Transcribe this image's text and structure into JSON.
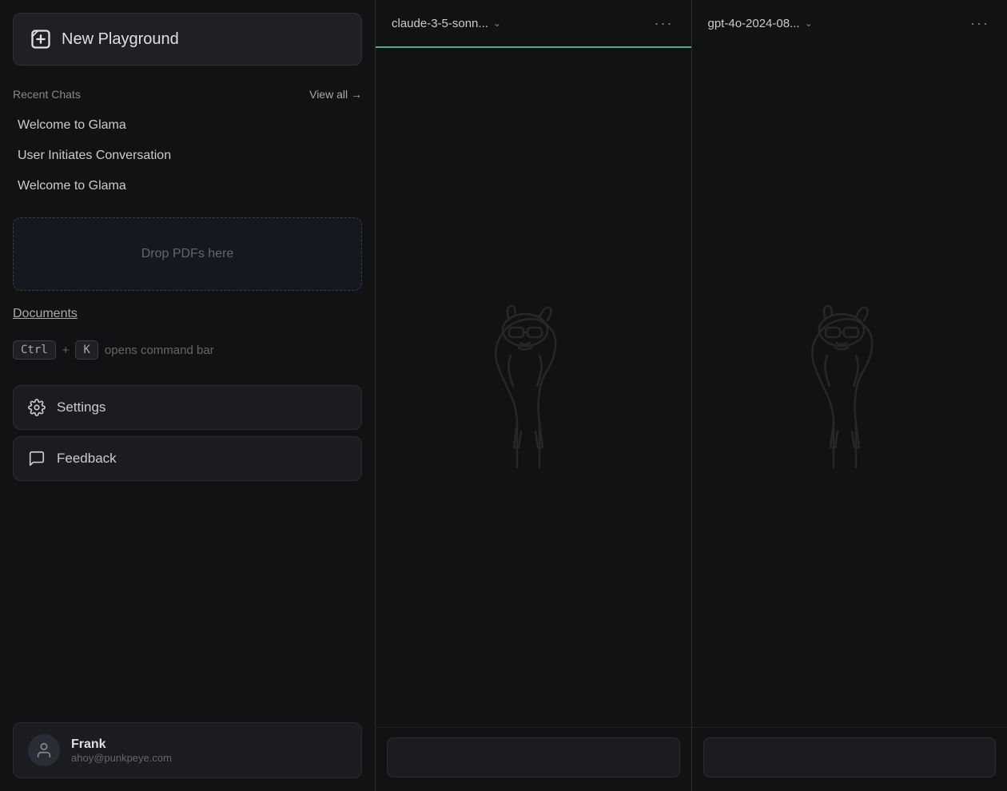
{
  "sidebar": {
    "new_playground_label": "New Playground",
    "recent_chats_label": "Recent Chats",
    "view_all_label": "View all →",
    "chats": [
      {
        "id": 1,
        "title": "Welcome to Glama"
      },
      {
        "id": 2,
        "title": "User Initiates Conversation"
      },
      {
        "id": 3,
        "title": "Welcome to Glama"
      }
    ],
    "drop_zone_label": "Drop PDFs here",
    "documents_label": "Documents",
    "keyboard_ctrl": "Ctrl",
    "keyboard_plus": "+",
    "keyboard_k": "K",
    "keyboard_hint": "opens command bar",
    "settings_label": "Settings",
    "feedback_label": "Feedback",
    "user": {
      "name": "Frank",
      "email": "ahoy@punkpeye.com"
    }
  },
  "panels": [
    {
      "id": "panel-1",
      "model_name": "claude-3-5-sonn...",
      "active": true,
      "input_placeholder": ""
    },
    {
      "id": "panel-2",
      "model_name": "gpt-4o-2024-08...",
      "active": false,
      "input_placeholder": ""
    }
  ],
  "colors": {
    "active_tab_border": "#4caf7d",
    "bg_main": "#111214",
    "bg_panel_header": "#111214"
  }
}
